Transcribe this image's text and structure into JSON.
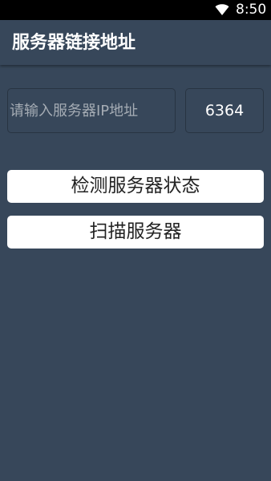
{
  "status_bar": {
    "time": "8:50",
    "wifi_icon": "wifi-icon"
  },
  "app_bar": {
    "title": "服务器链接地址"
  },
  "form": {
    "address_placeholder": "请输入服务器IP地址",
    "address_value": "",
    "port_value": "6364"
  },
  "buttons": {
    "check_label": "检测服务器状态",
    "scan_label": "扫描服务器"
  },
  "colors": {
    "background": "#37475a",
    "status_bar": "#000000",
    "button": "#ffffff",
    "button_text": "#222222",
    "input_border": "#283442",
    "placeholder": "#a5acb4"
  }
}
